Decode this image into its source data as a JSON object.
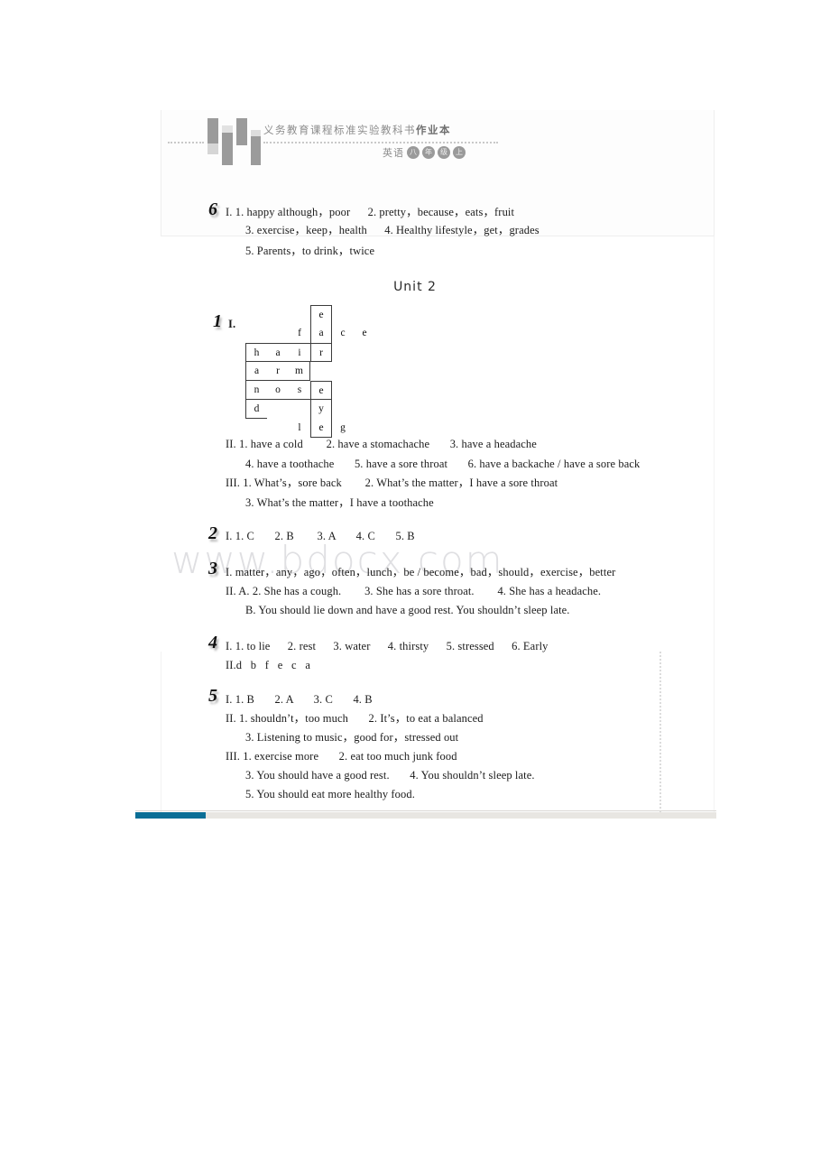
{
  "masthead": {
    "cn_series": "义务教育课程标准实验教科书",
    "cn_series_bold": "作业本",
    "subject_label": "英语",
    "grade_chips": [
      "八",
      "年",
      "级",
      "上"
    ]
  },
  "unit_heading": "Unit  2",
  "sections": [
    {
      "number": "6",
      "lines": [
        "I. 1. happy although，poor      2. pretty，because，eats，fruit",
        "3. exercise，keep，health      4. Healthy lifestyle，get，grades",
        "5. Parents，to drink，twice"
      ]
    },
    {
      "number": "1",
      "lines": [
        "I.",
        "II. 1. have a cold        2. have a stomachache       3. have a headache",
        "4. have a toothache       5. have a sore throat       6. have a backache / have a sore back",
        "III. 1. What’s，sore back        2. What’s the matter，I have a sore throat",
        "3. What’s the matter，I have a toothache"
      ]
    },
    {
      "number": "2",
      "lines": [
        "I. 1. C       2. B        3. A       4. C       5. B"
      ]
    },
    {
      "number": "3",
      "lines": [
        "I. matter，any，ago，often，lunch，be / become，bad，should，exercise，better",
        "II. A. 2. She has a cough.        3. She has a sore throat.        4. She has a headache.",
        "B. You should lie down and have a good rest. You shouldn’t sleep late."
      ]
    },
    {
      "number": "4",
      "lines": [
        "I. 1. to lie      2. rest      3. water      4. thirsty      5. stressed      6. Early",
        "II.d   b   f   e   c   a"
      ]
    },
    {
      "number": "5",
      "lines": [
        "I. 1. B       2. A       3. C       4. B",
        "II. 1. shouldn’t，too much       2. It’s，to eat a balanced",
        "3. Listening to music，good for，stressed out",
        "III. 1. exercise more       2. eat too much junk food",
        "3. You should have a good rest.       4. You shouldn’t sleep late.",
        "5. You should eat more healthy food."
      ]
    }
  ],
  "crossword": {
    "cells": [
      {
        "letter": "e",
        "col": 3,
        "row": 0,
        "style": "cw-bl cw-br cw-bt"
      },
      {
        "letter": "f",
        "col": 2,
        "row": 1,
        "style": ""
      },
      {
        "letter": "a",
        "col": 3,
        "row": 1,
        "style": "cw-bl cw-br"
      },
      {
        "letter": "c",
        "col": 4,
        "row": 1,
        "style": ""
      },
      {
        "letter": "e",
        "col": 5,
        "row": 1,
        "style": ""
      },
      {
        "letter": "h",
        "col": 0,
        "row": 2,
        "style": "cw-bl cw-bt cw-bb"
      },
      {
        "letter": "a",
        "col": 1,
        "row": 2,
        "style": "cw-bt cw-bb"
      },
      {
        "letter": "i",
        "col": 2,
        "row": 2,
        "style": "cw-bt cw-bb"
      },
      {
        "letter": "r",
        "col": 3,
        "row": 2,
        "style": "cw-bl cw-br cw-bt cw-bb"
      },
      {
        "letter": "a",
        "col": 0,
        "row": 3,
        "style": "cw-bl cw-bb"
      },
      {
        "letter": "r",
        "col": 1,
        "row": 3,
        "style": "cw-bb"
      },
      {
        "letter": "m",
        "col": 2,
        "row": 3,
        "style": "cw-bb cw-br"
      },
      {
        "letter": "n",
        "col": 0,
        "row": 4,
        "style": "cw-bl cw-bb"
      },
      {
        "letter": "o",
        "col": 1,
        "row": 4,
        "style": "cw-bb"
      },
      {
        "letter": "s",
        "col": 2,
        "row": 4,
        "style": "cw-bb"
      },
      {
        "letter": "e",
        "col": 3,
        "row": 4,
        "style": "cw-bl cw-br cw-bt cw-bb"
      },
      {
        "letter": "d",
        "col": 0,
        "row": 5,
        "style": "cw-bl cw-bb"
      },
      {
        "letter": "y",
        "col": 3,
        "row": 5,
        "style": "cw-bl cw-br"
      },
      {
        "letter": "l",
        "col": 2,
        "row": 6,
        "style": ""
      },
      {
        "letter": "e",
        "col": 3,
        "row": 6,
        "style": "cw-bl cw-br cw-bb"
      },
      {
        "letter": "g",
        "col": 4,
        "row": 6,
        "style": ""
      }
    ]
  },
  "watermark": "www.bdocx.com",
  "footer": {
    "progress_color": "#0b6e96",
    "track_color": "#e8e6e2"
  }
}
